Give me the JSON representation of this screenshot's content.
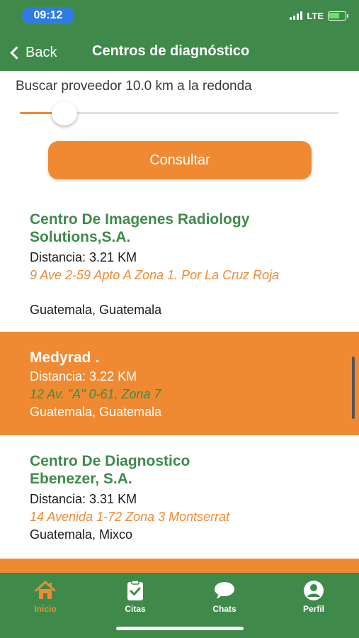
{
  "status_bar": {
    "time": "09:12",
    "network": "LTE"
  },
  "nav": {
    "back_label": "Back",
    "title": "Centros de diagnóstico"
  },
  "search": {
    "label": "Buscar proveedor 10.0 km a la redonda",
    "slider_fraction": 0.14
  },
  "consult_button": "Consultar",
  "providers": [
    {
      "name": "Centro De Imagenes Radiology Solutions,S.A.",
      "distance": "Distancia: 3.21 KM",
      "address": "9 Ave 2-59 Apto A Zona 1. Por La Cruz Roja",
      "city": "Guatemala, Guatemala",
      "highlighted": false
    },
    {
      "name": "Medyrad .",
      "distance": "Distancia: 3.22 KM",
      "address": "12 Av. \"A\" 0-61, Zona 7",
      "city": "Guatemala, Guatemala",
      "highlighted": true
    },
    {
      "name": "Centro De Diagnostico Ebenezer, S.A.",
      "distance": "Distancia: 3.31 KM",
      "address": "14 Avenida 1-72 Zona 3 Montserrat",
      "city": "Guatemala, Mixco",
      "highlighted": false
    }
  ],
  "tabs": [
    {
      "label": "Inicio",
      "icon": "home-icon",
      "active": true
    },
    {
      "label": "Citas",
      "icon": "clipboard-check-icon",
      "active": false
    },
    {
      "label": "Chats",
      "icon": "chat-bubble-icon",
      "active": false
    },
    {
      "label": "Perfil",
      "icon": "user-icon",
      "active": false
    }
  ],
  "colors": {
    "brand_green": "#3f8a4b",
    "accent_orange": "#ef8a33",
    "time_pill_blue": "#2f7be6"
  }
}
